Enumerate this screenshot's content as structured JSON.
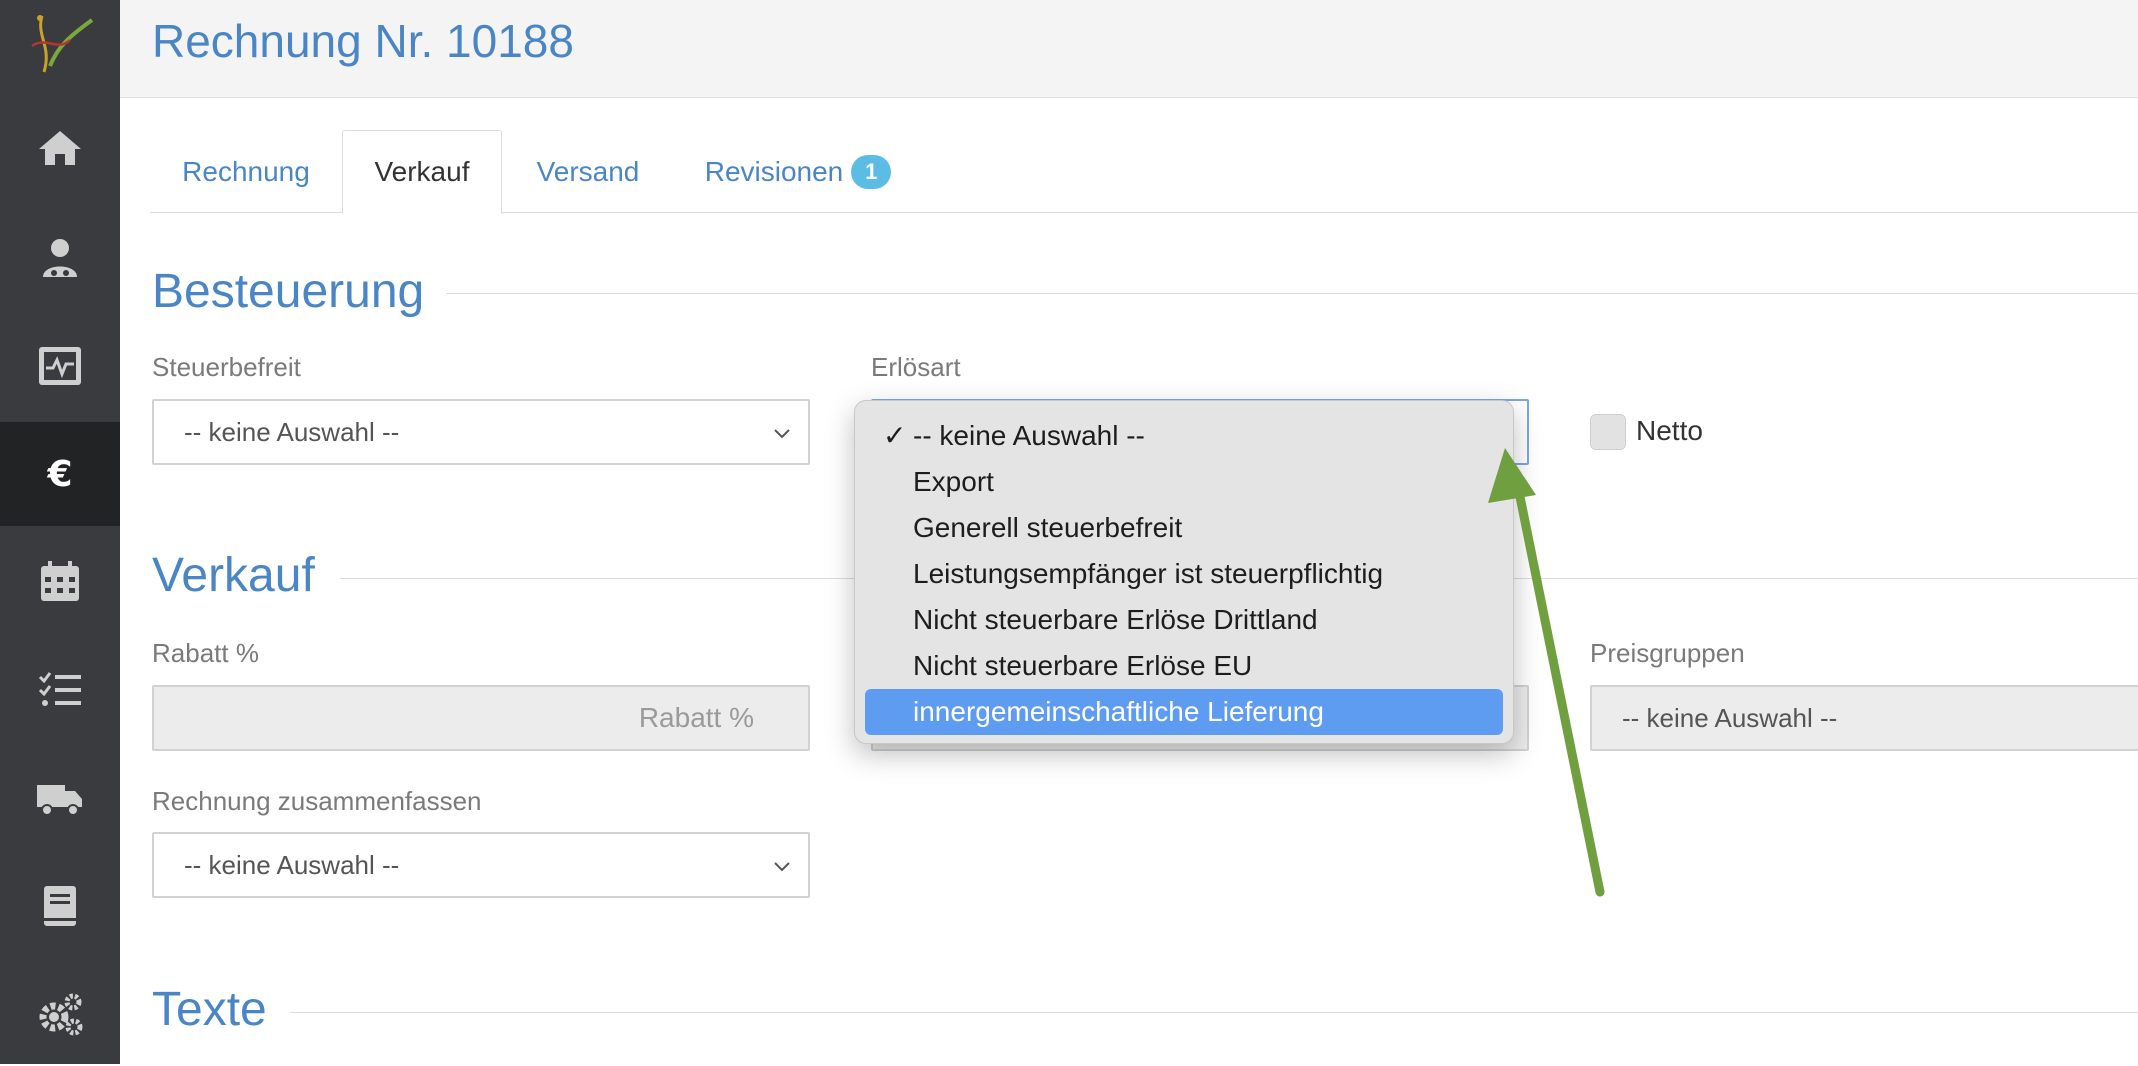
{
  "header": {
    "title": "Rechnung Nr. 10188"
  },
  "sidebar": {
    "items": [
      {
        "icon": "home-icon"
      },
      {
        "icon": "doctor-icon"
      },
      {
        "icon": "monitor-chart-icon"
      },
      {
        "icon": "euro-icon",
        "active": true
      },
      {
        "icon": "calendar-icon"
      },
      {
        "icon": "checklist-icon"
      },
      {
        "icon": "truck-icon"
      },
      {
        "icon": "book-icon"
      },
      {
        "icon": "gears-icon"
      }
    ]
  },
  "tabs": [
    {
      "label": "Rechnung"
    },
    {
      "label": "Verkauf",
      "active": true
    },
    {
      "label": "Versand"
    },
    {
      "label": "Revisionen",
      "badge": "1"
    }
  ],
  "sections": {
    "besteuerung": "Besteuerung",
    "verkauf": "Verkauf",
    "texte": "Texte"
  },
  "besteuerung": {
    "steuerbefreit_label": "Steuerbefreit",
    "steuerbefreit_value": "-- keine Auswahl --",
    "erloesart_label": "Erlösart",
    "netto_label": "Netto",
    "erloesart_options": [
      {
        "label": "-- keine Auswahl --",
        "checked": true
      },
      {
        "label": "Export"
      },
      {
        "label": "Generell steuerbefreit"
      },
      {
        "label": "Leistungsempfänger ist steuerpflichtig"
      },
      {
        "label": "Nicht steuerbare Erlöse Drittland"
      },
      {
        "label": "Nicht steuerbare Erlöse EU"
      },
      {
        "label": "innergemeinschaftliche Lieferung",
        "highlighted": true
      }
    ],
    "checkmark": "✓"
  },
  "verkauf": {
    "rabatt_label": "Rabatt %",
    "rabatt_placeholder": "Rabatt %",
    "preisgruppen_label": "Preisgruppen",
    "preisgruppen_value": "-- keine Auswahl --",
    "zusammenfassen_label": "Rechnung zusammenfassen",
    "zusammenfassen_value": "-- keine Auswahl --"
  },
  "colors": {
    "accent": "#4a86c5",
    "sidebar": "#3a3b3e",
    "highlight": "#5e9cf2",
    "arrow": "#6f9f3f",
    "badge": "#5bbde4"
  }
}
